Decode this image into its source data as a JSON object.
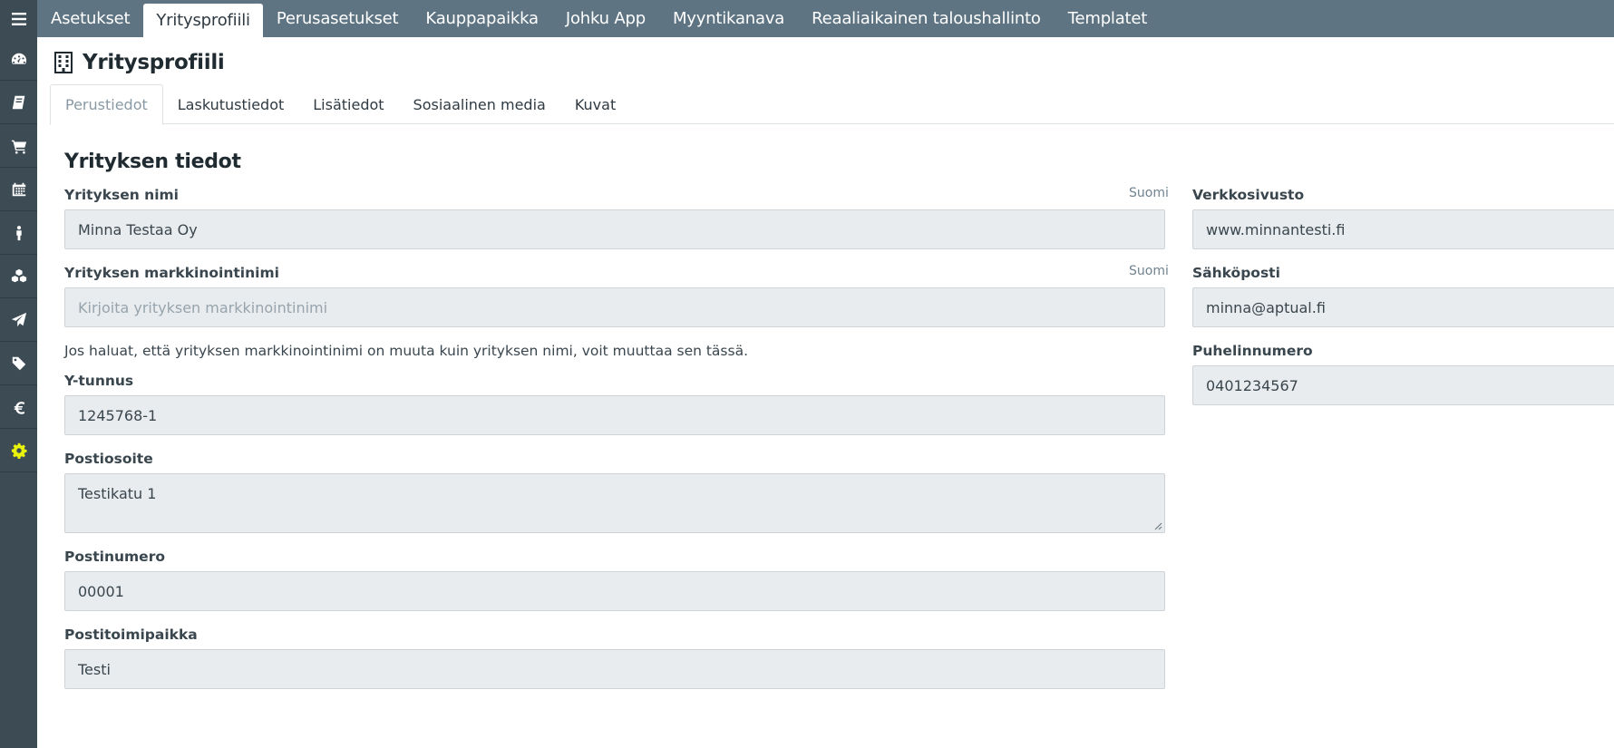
{
  "sidebar": {
    "items": [
      {
        "icon": "dashboard-icon"
      },
      {
        "icon": "book-icon"
      },
      {
        "icon": "cart-icon"
      },
      {
        "icon": "calendar-icon"
      },
      {
        "icon": "person-icon"
      },
      {
        "icon": "boxes-icon"
      },
      {
        "icon": "paper-plane-icon"
      },
      {
        "icon": "tag-icon"
      },
      {
        "icon": "euro-icon"
      },
      {
        "icon": "gear-icon",
        "active": true
      }
    ],
    "active_color": "#e8f20a"
  },
  "topnav": {
    "tabs": [
      "Asetukset",
      "Yritysprofiili",
      "Perusasetukset",
      "Kauppapaikka",
      "Johku App",
      "Myyntikanava",
      "Reaaliaikainen taloushallinto",
      "Templatet"
    ],
    "active_index": 1
  },
  "page": {
    "title": "Yritysprofiili"
  },
  "subtabs": {
    "tabs": [
      "Perustiedot",
      "Laskutustiedot",
      "Lisätiedot",
      "Sosiaalinen media",
      "Kuvat"
    ],
    "active_index": 0
  },
  "form": {
    "section_title": "Yrityksen tiedot",
    "company_name": {
      "label": "Yrityksen nimi",
      "lang": "Suomi",
      "value": "Minna Testaa Oy"
    },
    "marketing_name": {
      "label": "Yrityksen markkinointinimi",
      "lang": "Suomi",
      "placeholder": "Kirjoita yrityksen markkinointinimi"
    },
    "marketing_help": "Jos haluat, että yrityksen markkinointinimi on muuta kuin yrityksen nimi, voit muuttaa sen tässä.",
    "business_id": {
      "label": "Y-tunnus",
      "value": "1245768-1"
    },
    "postal_address": {
      "label": "Postiosoite",
      "value": "Testikatu 1"
    },
    "postal_code": {
      "label": "Postinumero",
      "value": "00001"
    },
    "city": {
      "label": "Postitoimipaikka",
      "value": "Testi"
    },
    "website": {
      "label": "Verkkosivusto",
      "value": "www.minnantesti.fi"
    },
    "email": {
      "label": "Sähköposti",
      "value": "minna@aptual.fi"
    },
    "phone": {
      "label": "Puhelinnumero",
      "value": "0401234567"
    }
  }
}
